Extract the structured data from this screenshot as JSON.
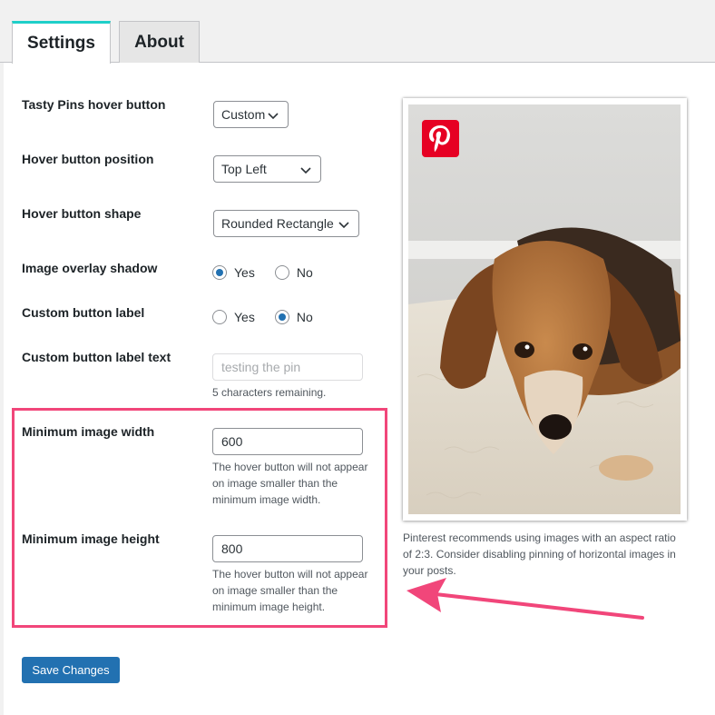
{
  "tabs": [
    {
      "label": "Settings",
      "active": true
    },
    {
      "label": "About",
      "active": false
    }
  ],
  "fields": {
    "hover_button": {
      "label": "Tasty Pins hover button",
      "selected": "Custom"
    },
    "position": {
      "label": "Hover button position",
      "selected": "Top Left"
    },
    "shape": {
      "label": "Hover button shape",
      "selected": "Rounded Rectangle"
    },
    "overlay_shadow": {
      "label": "Image overlay shadow",
      "options": [
        "Yes",
        "No"
      ],
      "checked": "Yes"
    },
    "custom_label": {
      "label": "Custom button label",
      "options": [
        "Yes",
        "No"
      ],
      "checked": "No"
    },
    "custom_label_text": {
      "label": "Custom button label text",
      "placeholder": "testing the pin",
      "hint": "5 characters remaining."
    },
    "min_width": {
      "label": "Minimum image width",
      "value": "600",
      "desc": "The hover button will not appear on image smaller than the minimum image width."
    },
    "min_height": {
      "label": "Minimum image height",
      "value": "800",
      "desc": "The hover button will not appear on image smaller than the minimum image height."
    }
  },
  "save_label": "Save Changes",
  "preview": {
    "note": "Pinterest recommends using images with an aspect ratio of 2:3. Consider disabling pinning of horizontal images in your posts.",
    "pin_icon": "pinterest-icon"
  },
  "colors": {
    "accent": "#2271b1",
    "tab_indicator": "#1fcfc9",
    "highlight": "#f1467a",
    "pinterest": "#e60023"
  }
}
